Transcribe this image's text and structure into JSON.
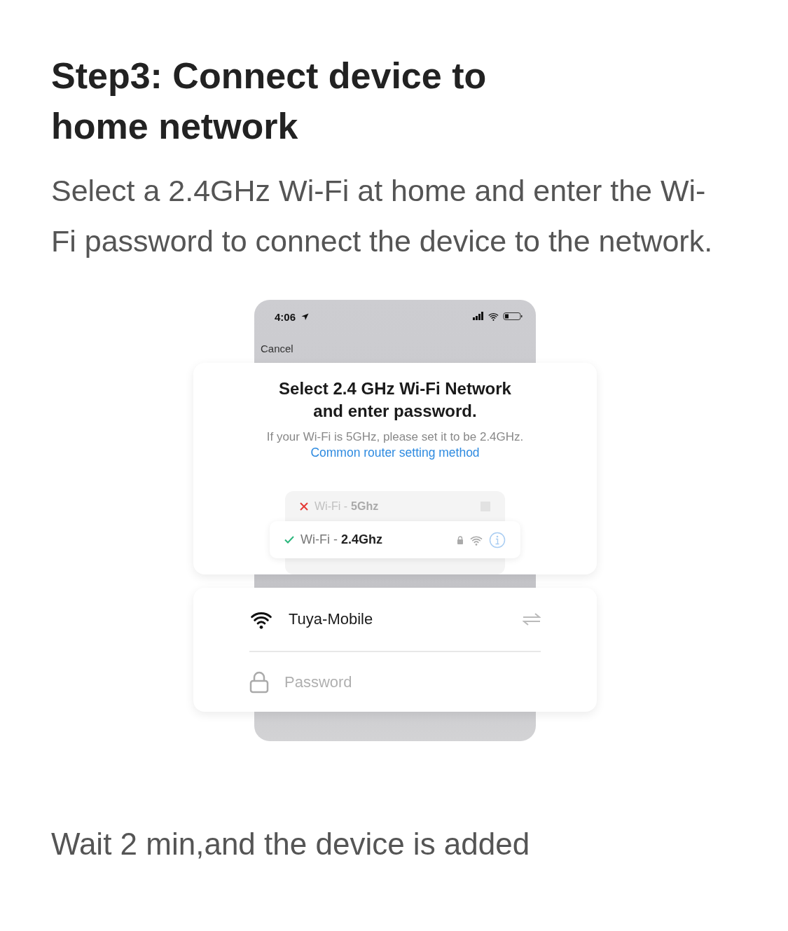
{
  "heading": "Step3: Connect device to home network",
  "description": "Select a 2.4GHz Wi-Fi at home and enter the Wi-Fi password to connect the device to the network.",
  "phone": {
    "time": "4:06",
    "cancel": "Cancel"
  },
  "dialog": {
    "title_lines": [
      "Select 2.4 GHz Wi-Fi Network",
      "and enter password."
    ],
    "hint": "If your Wi-Fi is 5GHz, please set it to be 2.4GHz.",
    "link": "Common router setting method"
  },
  "networks": [
    {
      "prefix": "Wi-Fi -",
      "band": "5Ghz",
      "supported": false,
      "selected": false
    },
    {
      "prefix": "Wi-Fi -",
      "band": "2.4Ghz",
      "supported": true,
      "selected": true
    }
  ],
  "form": {
    "ssid": "Tuya-Mobile",
    "password_placeholder": "Password"
  },
  "footer": "Wait 2 min,and the device is added"
}
